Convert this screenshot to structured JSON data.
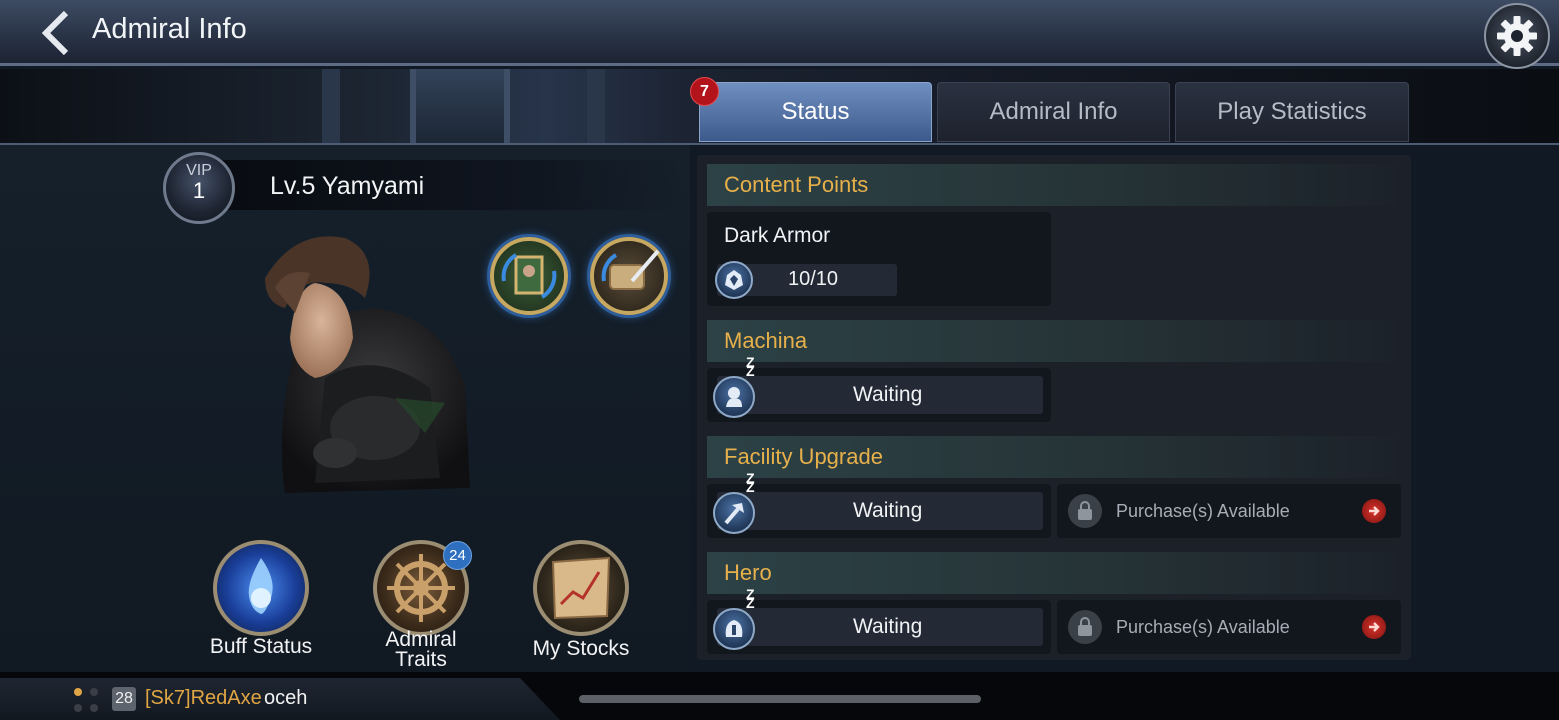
{
  "header": {
    "title": "Admiral Info"
  },
  "tabs": {
    "status": {
      "label": "Status",
      "badge": "7"
    },
    "admiral_info": {
      "label": "Admiral Info"
    },
    "play_statistics": {
      "label": "Play Statistics"
    }
  },
  "profile": {
    "vip_label": "VIP",
    "vip_level": "1",
    "name": "Lv.5 Yamyami"
  },
  "menu": {
    "buff_status": "Buff Status",
    "admiral_traits_line1": "Admiral",
    "admiral_traits_line2": "Traits",
    "admiral_traits_badge": "24",
    "my_stocks": "My Stocks"
  },
  "content": {
    "content_points": {
      "title": "Content Points",
      "item_name": "Dark Armor",
      "value": "10/10"
    },
    "machina": {
      "title": "Machina",
      "status": "Waiting"
    },
    "facility_upgrade": {
      "title": "Facility Upgrade",
      "status": "Waiting",
      "purchase": "Purchase(s) Available"
    },
    "hero": {
      "title": "Hero",
      "status": "Waiting",
      "purchase": "Purchase(s) Available"
    },
    "sleep_glyph": "Z"
  },
  "chat": {
    "level": "28",
    "sender": "[Sk7]RedAxe",
    "message": "oceh"
  },
  "colors": {
    "accent_gold": "#e8b04a",
    "tab_active": "#4f6fa3",
    "badge_red": "#b3141b",
    "badge_blue": "#2e6fc0"
  }
}
